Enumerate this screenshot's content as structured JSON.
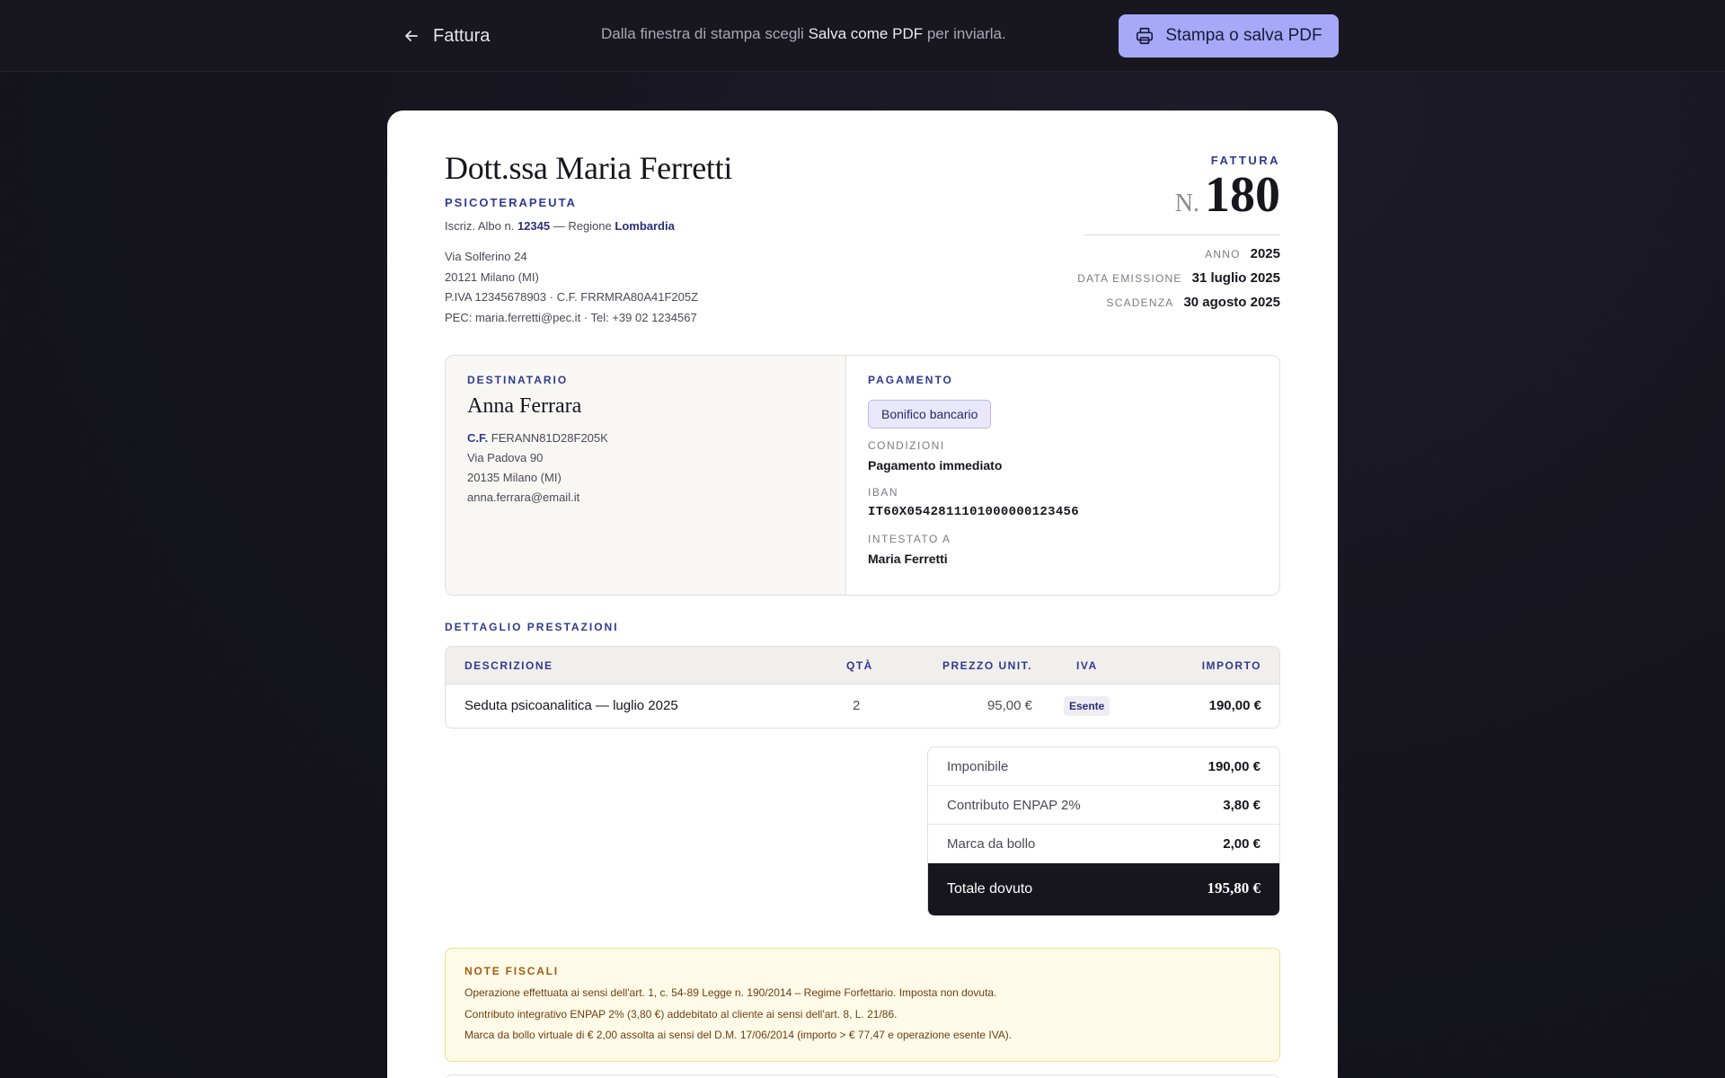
{
  "topbar": {
    "back_label": "Fattura",
    "hint_prefix": "Dalla finestra di stampa scegli",
    "hint_strong": "Salva come PDF",
    "hint_suffix": "per inviarla.",
    "print_button": "Stampa o salva PDF"
  },
  "issuer": {
    "name": "Dott.ssa Maria Ferretti",
    "role": "PSICOTERAPEUTA",
    "albo_prefix": "Iscriz. Albo n.",
    "albo_number": "12345",
    "albo_mid": "— Regione",
    "albo_region": "Lombardia",
    "address_lines": [
      "Via Solferino 24",
      "20121 Milano (MI)",
      "P.IVA 12345678903 · C.F. FRRMRA80A41F205Z",
      "PEC: maria.ferretti@pec.it · Tel: +39 02 1234567"
    ]
  },
  "invoice": {
    "label": "FATTURA",
    "number_prefix": "N.",
    "number": "180",
    "meta": [
      {
        "key": "ANNO",
        "value": "2025"
      },
      {
        "key": "DATA EMISSIONE",
        "value": "31 luglio 2025"
      },
      {
        "key": "SCADENZA",
        "value": "30 agosto 2025"
      }
    ]
  },
  "recipient": {
    "label": "DESTINATARIO",
    "name": "Anna Ferrara",
    "cf_label": "C.F.",
    "cf": "FERANN81D28F205K",
    "lines": [
      "Via Padova 90",
      "20135 Milano (MI)",
      "anna.ferrara@email.it"
    ]
  },
  "payment": {
    "label": "PAGAMENTO",
    "method": "Bonifico bancario",
    "conditions_label": "CONDIZIONI",
    "conditions": "Pagamento immediato",
    "iban_label": "IBAN",
    "iban": "IT60X0542811101000000123456",
    "holder_label": "INTESTATO A",
    "holder": "Maria Ferretti"
  },
  "services": {
    "label": "DETTAGLIO PRESTAZIONI",
    "headers": {
      "desc": "DESCRIZIONE",
      "qty": "QTÀ",
      "price": "PREZZO UNIT.",
      "vat": "IVA",
      "amount": "IMPORTO"
    },
    "rows": [
      {
        "desc": "Seduta psicoanalitica — luglio 2025",
        "qty": "2",
        "price": "95,00 €",
        "vat": "Esente",
        "amount": "190,00 €"
      }
    ]
  },
  "totals": {
    "rows": [
      {
        "label": "Imponibile",
        "value": "190,00 €"
      },
      {
        "label": "Contributo ENPAP 2%",
        "value": "3,80 €"
      },
      {
        "label": "Marca da bollo",
        "value": "2,00 €"
      }
    ],
    "final_label": "Totale dovuto",
    "final_value": "195,80 €"
  },
  "notes": {
    "title": "NOTE FISCALI",
    "lines": [
      "Operazione effettuata ai sensi dell'art. 1, c. 54-89 Legge n. 190/2014 – Regime Forfettario. Imposta non dovuta.",
      "Contributo integrativo ENPAP 2% (3,80 €) addebitato al cliente ai sensi dell'art. 8, L. 21/86.",
      "Marca da bollo virtuale di € 2,00 assolta ai sensi del D.M. 17/06/2014 (importo > € 77,47 e operazione esente IVA)."
    ]
  },
  "colors": {
    "accent": "#2f3a8f",
    "button": "#a6a9f8",
    "dark": "#17161d",
    "note_bg": "#fffbe8"
  }
}
